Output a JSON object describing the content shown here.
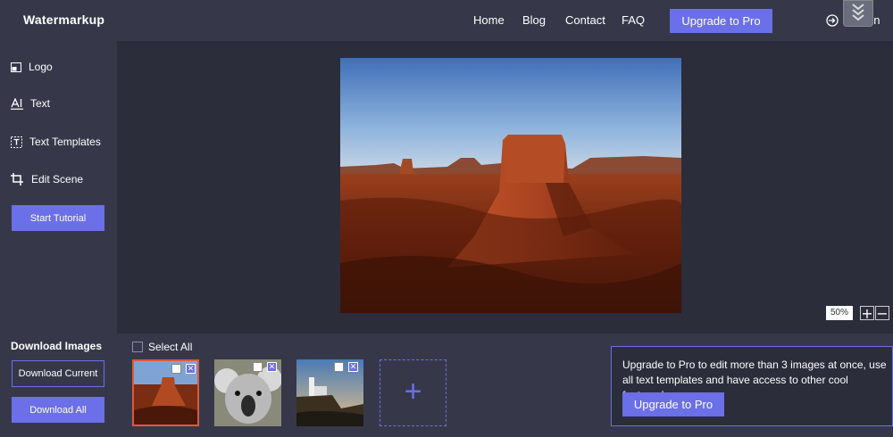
{
  "app": {
    "name": "Watermarkup"
  },
  "nav": {
    "home": "Home",
    "blog": "Blog",
    "contact": "Contact",
    "faq": "FAQ",
    "upgrade": "Upgrade to Pro",
    "signin": "Sign In"
  },
  "sidebar": {
    "items": [
      {
        "label": "Logo",
        "icon": "logo-icon"
      },
      {
        "label": "Text",
        "icon": "text-icon"
      },
      {
        "label": "Text Templates",
        "icon": "text-templates-icon"
      },
      {
        "label": "Edit Scene",
        "icon": "crop-icon"
      }
    ],
    "tutorial": "Start Tutorial",
    "download_title": "Download Images",
    "download_current": "Download Current",
    "download_all": "Download All"
  },
  "canvas": {
    "zoom": "50%"
  },
  "gallery": {
    "select_all": "Select All",
    "thumbnails": [
      {
        "name": "desert-mesa",
        "selected": true
      },
      {
        "name": "koala",
        "selected": false
      },
      {
        "name": "lighthouse",
        "selected": false
      }
    ],
    "add_symbol": "+"
  },
  "promo": {
    "text": "Upgrade to Pro to edit more than 3 images at once, use all text templates and have access to other cool features!",
    "button": "Upgrade to Pro"
  },
  "colors": {
    "accent": "#6b6fe8",
    "panel": "#363849",
    "background": "#2b2d3b",
    "selected_border": "#e0583a"
  }
}
